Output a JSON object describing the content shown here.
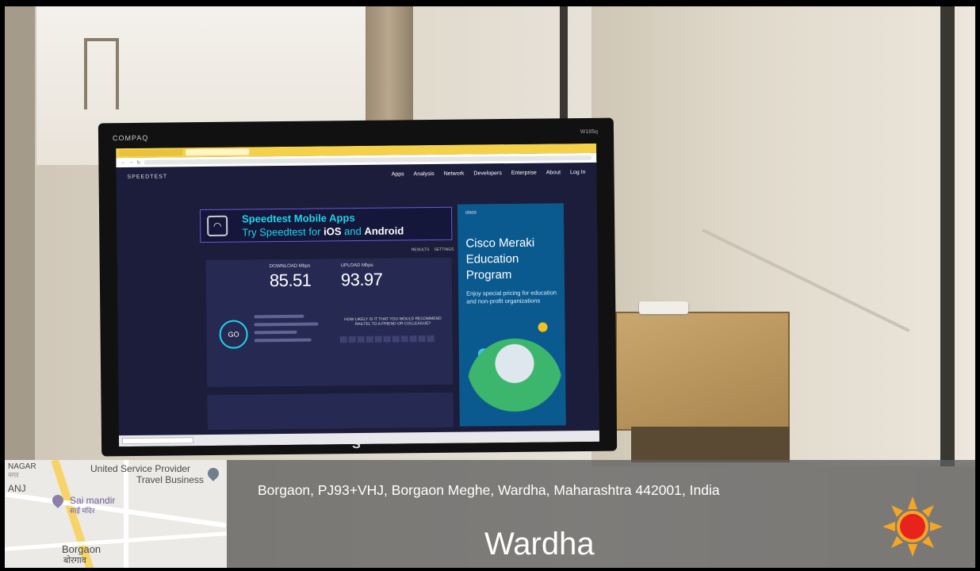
{
  "monitor": {
    "brand": "COMPAQ",
    "model": "W185q",
    "stand_logo": "S"
  },
  "speedtest_page": {
    "logo": "SPEEDTEST",
    "nav": [
      "Apps",
      "Analysis",
      "Network",
      "Developers",
      "Enterprise",
      "About",
      "Log In"
    ],
    "banner_line1": "Speedtest Mobile Apps",
    "banner_line2_prefix": "Try Speedtest for ",
    "banner_ios": "iOS",
    "banner_and": " and ",
    "banner_android": "Android",
    "results_label": "RESULTS",
    "settings_label": "SETTINGS",
    "download_label": "DOWNLOAD Mbps",
    "download_value": "85.51",
    "upload_label": "UPLOAD Mbps",
    "upload_value": "93.97",
    "go_label": "GO",
    "survey_text": "HOW LIKELY IS IT THAT YOU WOULD RECOMMEND RAILTEL TO A FRIEND OR COLLEAGUE?",
    "ad": {
      "brand": "cisco",
      "headline": "Cisco Meraki Education Program",
      "body": "Enjoy special pricing for education and non-profit organizations"
    }
  },
  "map": {
    "top_left_label": "NAGAR",
    "top_left_sub": "नगर",
    "left_label": "ANJ",
    "business_name_1": "United Service Provider",
    "business_name_2": "Travel Business",
    "temple_name": "Sai mandir",
    "temple_sub": "साई मंदिर",
    "area_name": "Borgaon",
    "area_sub": "बोरगाव"
  },
  "location": {
    "address": "Borgaon, PJ93+VHJ, Borgaon Meghe, Wardha, Maharashtra 442001, India",
    "city": "Wardha"
  },
  "weather": {
    "icon": "sun-icon"
  },
  "colors": {
    "overlay": "#5f5f5f",
    "speedtest_bg": "#1b1d3a",
    "speedtest_accent": "#1fd3ee",
    "browser_tab_bar": "#f5d14a",
    "ad_bg": "#0b5a8f",
    "sun_core": "#e8231c",
    "sun_rays": "#f6a623"
  }
}
